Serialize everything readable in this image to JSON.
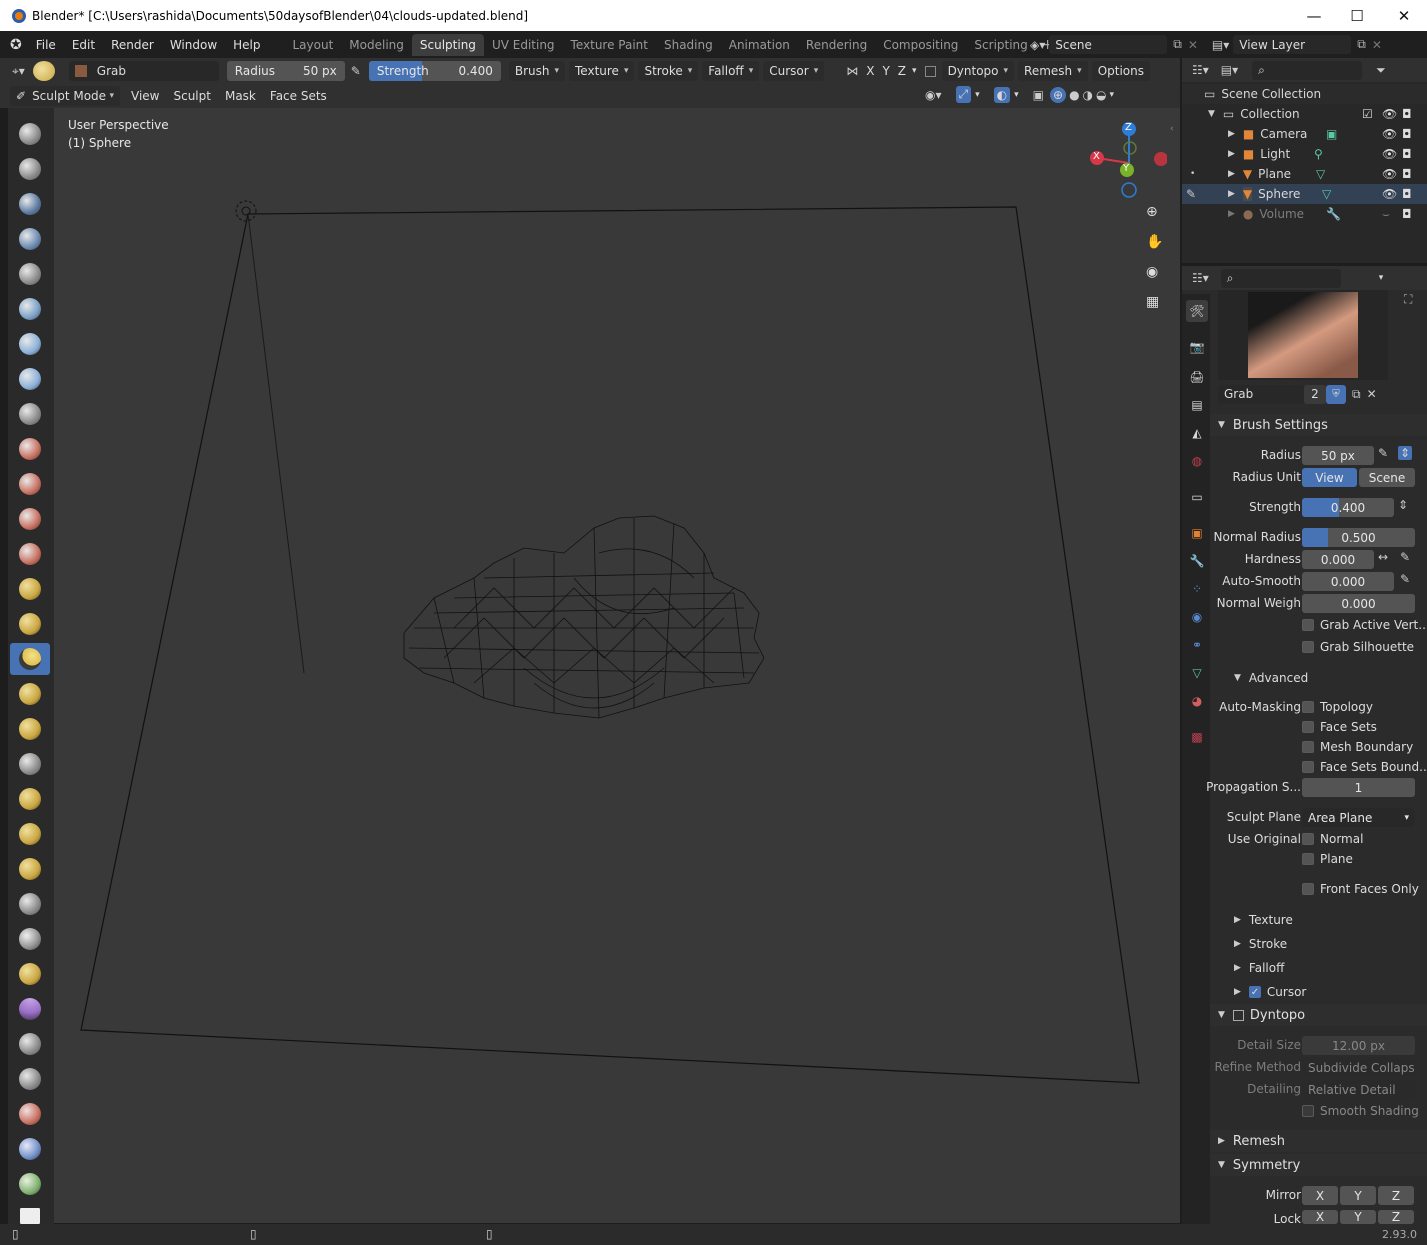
{
  "window": {
    "title": "Blender* [C:\\Users\\rashida\\Documents\\50daysofBlender\\04\\clouds-updated.blend]",
    "minimize": "—",
    "maximize": "☐",
    "close": "✕"
  },
  "menu": [
    "File",
    "Edit",
    "Render",
    "Window",
    "Help"
  ],
  "workspaces": [
    "Layout",
    "Modeling",
    "Sculpting",
    "UV Editing",
    "Texture Paint",
    "Shading",
    "Animation",
    "Rendering",
    "Compositing",
    "Scripting"
  ],
  "active_workspace": "Sculpting",
  "scene": {
    "name": "Scene",
    "view_layer": "View Layer"
  },
  "tool_header": {
    "brush_name": "Grab",
    "radius_label": "Radius",
    "radius_value": "50 px",
    "strength_label": "Strength",
    "strength_value": "0.400",
    "strength_fraction": 0.4,
    "brush": "Brush",
    "texture": "Texture",
    "stroke": "Stroke",
    "falloff": "Falloff",
    "cursor": "Cursor",
    "x": "X",
    "y": "Y",
    "z": "Z",
    "dyntopo": "Dyntopo",
    "remesh": "Remesh",
    "options": "Options"
  },
  "mode_header": {
    "mode": "Sculpt Mode",
    "items": [
      "View",
      "Sculpt",
      "Mask",
      "Face Sets"
    ]
  },
  "viewport": {
    "perspective": "User Perspective",
    "object": "(1) Sphere",
    "gizmo": {
      "x": "X",
      "y": "Y",
      "z": "Z"
    }
  },
  "outliner": {
    "root": "Scene Collection",
    "collection": "Collection",
    "items": [
      {
        "name": "Camera",
        "color": "#e0873a"
      },
      {
        "name": "Light",
        "color": "#e0873a"
      },
      {
        "name": "Plane",
        "color": "#e0873a"
      },
      {
        "name": "Sphere",
        "color": "#e0873a"
      },
      {
        "name": "Volume",
        "color": "#8a6a55"
      }
    ]
  },
  "properties": {
    "brush_name": "Grab",
    "users": "2",
    "brush_settings": {
      "title": "Brush Settings",
      "radius_label": "Radius",
      "radius": "50 px",
      "radius_unit_label": "Radius Unit",
      "unit_view": "View",
      "unit_scene": "Scene",
      "strength_label": "Strength",
      "strength": "0.400",
      "normal_radius_label": "Normal Radius",
      "normal_radius": "0.500",
      "hardness_label": "Hardness",
      "hardness": "0.000",
      "auto_smooth_label": "Auto-Smooth",
      "auto_smooth": "0.000",
      "normal_weight_label": "Normal Weigh",
      "normal_weight": "0.000",
      "grab_active": "Grab Active Vert...",
      "grab_silhouette": "Grab Silhouette"
    },
    "advanced": {
      "title": "Advanced",
      "auto_masking_label": "Auto-Masking",
      "topology": "Topology",
      "face_sets": "Face Sets",
      "mesh_boundary": "Mesh Boundary",
      "face_sets_boundary": "Face Sets Bound...",
      "propagation_label": "Propagation S...",
      "propagation": "1",
      "sculpt_plane_label": "Sculpt Plane",
      "sculpt_plane": "Area Plane",
      "use_original_label": "Use Original",
      "normal": "Normal",
      "plane": "Plane",
      "front_faces": "Front Faces Only"
    },
    "collapsed": [
      "Texture",
      "Stroke",
      "Falloff"
    ],
    "cursor": "Cursor",
    "dyntopo": {
      "title": "Dyntopo",
      "detail_size_label": "Detail Size",
      "detail_size": "12.00 px",
      "refine_label": "Refine Method",
      "refine": "Subdivide Collapse",
      "detailing_label": "Detailing",
      "detailing": "Relative Detail",
      "smooth_shading": "Smooth Shading"
    },
    "remesh": "Remesh",
    "symmetry": {
      "title": "Symmetry",
      "mirror_label": "Mirror",
      "lock_label": "Lock",
      "x": "X",
      "y": "Y",
      "z": "Z"
    }
  },
  "status": {
    "version": "2.93.0"
  }
}
